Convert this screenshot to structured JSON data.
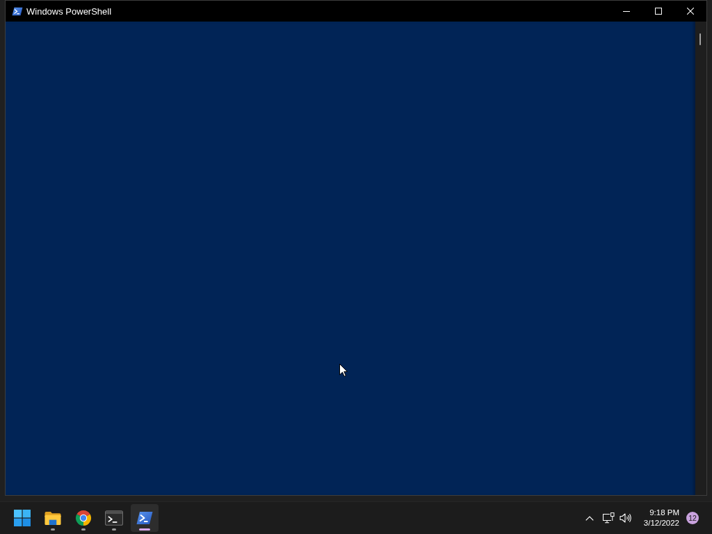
{
  "window": {
    "title": "Windows PowerShell"
  },
  "taskbar": {
    "apps": [
      {
        "kind": "start",
        "running": false,
        "selected": false
      },
      {
        "kind": "folder",
        "running": true,
        "selected": false
      },
      {
        "kind": "browser",
        "running": true,
        "selected": false
      },
      {
        "kind": "terminal",
        "running": true,
        "selected": false
      },
      {
        "kind": "shell",
        "running": true,
        "selected": true
      }
    ]
  },
  "tray": {
    "time": "9:18 PM",
    "date": "3/12/2022",
    "notifications": "12"
  }
}
